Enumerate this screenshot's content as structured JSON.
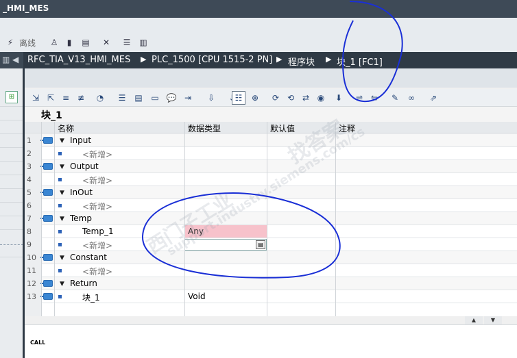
{
  "window": {
    "title": "_HMI_MES"
  },
  "toolbar_main": {
    "offline_label": "离线"
  },
  "breadcrumb": [
    "RFC_TIA_V13_HMI_MES",
    "PLC_1500 [CPU 1515-2 PN]",
    "程序块",
    "块_1 [FC1]"
  ],
  "block_title": "块_1",
  "columns": {
    "name": "名称",
    "datatype": "数据类型",
    "default": "默认值",
    "comment": "注释"
  },
  "rows": [
    {
      "num": "1",
      "name": "Input",
      "datatype": ""
    },
    {
      "num": "2",
      "name": "<新增>",
      "datatype": ""
    },
    {
      "num": "3",
      "name": "Output",
      "datatype": ""
    },
    {
      "num": "4",
      "name": "<新增>",
      "datatype": ""
    },
    {
      "num": "5",
      "name": "InOut",
      "datatype": ""
    },
    {
      "num": "6",
      "name": "<新增>",
      "datatype": ""
    },
    {
      "num": "7",
      "name": "Temp",
      "datatype": ""
    },
    {
      "num": "8",
      "name": "Temp_1",
      "datatype": "Any"
    },
    {
      "num": "9",
      "name": "<新增>",
      "datatype": ""
    },
    {
      "num": "10",
      "name": "Constant",
      "datatype": ""
    },
    {
      "num": "11",
      "name": "<新增>",
      "datatype": ""
    },
    {
      "num": "12",
      "name": "Return",
      "datatype": ""
    },
    {
      "num": "13",
      "name": "块_1",
      "datatype": "Void"
    }
  ],
  "bottom": {
    "label": "CALL"
  },
  "watermark": {
    "line1": "西门子工业",
    "line2": "support.industry.siemens.com/cs",
    "line3": "找答案"
  },
  "colors": {
    "error_cell": "#f7c2cb",
    "annotation_ink": "#1a2fd6",
    "titlebar": "#3e4a57"
  }
}
